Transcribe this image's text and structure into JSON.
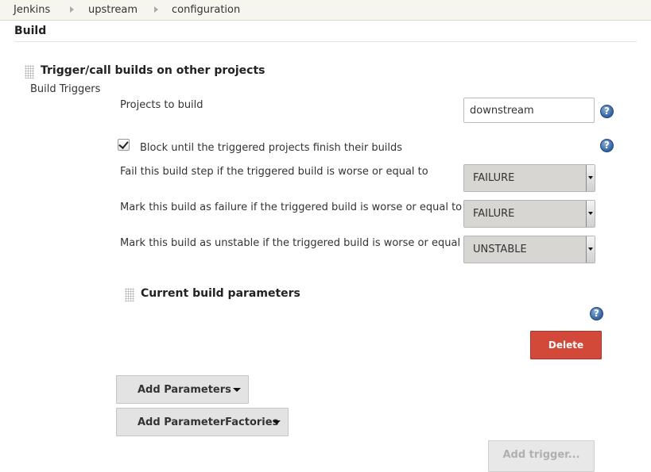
{
  "breadcrumb": {
    "items": [
      "Jenkins",
      "upstream",
      "configuration"
    ]
  },
  "section": {
    "title": "Build"
  },
  "build_step": {
    "title": "Trigger/call builds on other projects",
    "subtitle": "Build Triggers",
    "projects_label": "Projects to build",
    "projects_value": "downstream",
    "block_checkbox": {
      "label": "Block until the triggered projects finish their builds",
      "checked": true
    },
    "fail_step": {
      "label": "Fail this build step if the triggered build is worse or equal to",
      "value": "FAILURE"
    },
    "mark_failure": {
      "label": "Mark this build as failure if the triggered build is worse or equal to",
      "value": "FAILURE"
    },
    "mark_unstable": {
      "label": "Mark this build as unstable if the triggered build is worse or equal to",
      "value": "UNSTABLE"
    },
    "params_block": {
      "title": "Current build parameters"
    },
    "delete_label": "Delete",
    "add_parameters_label": "Add Parameters",
    "add_factories_label": "Add ParameterFactories",
    "add_trigger_label": "Add trigger..."
  },
  "help_glyph": "?",
  "colors": {
    "breadcrumb_bg": "#f6f6ef",
    "delete_red": "#d24939",
    "help_blue": "#3b6aa8",
    "select_bg": "#d8d6d2"
  },
  "icons": [
    "breadcrumb-arrow-icon",
    "drag-handle-icon",
    "help-icon",
    "checkmark-icon",
    "dropdown-caret-icon"
  ]
}
